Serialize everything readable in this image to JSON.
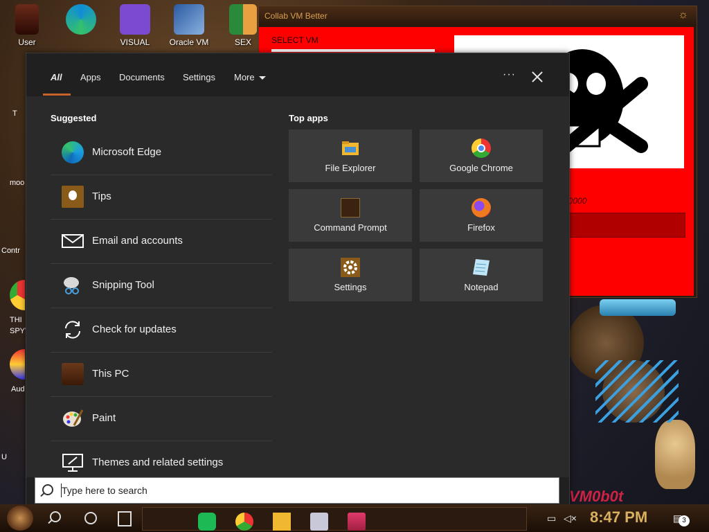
{
  "desktop": {
    "icons": [
      {
        "label": "User"
      },
      {
        "label": ""
      },
      {
        "label": "VISUAL"
      },
      {
        "label": "Oracle VM"
      },
      {
        "label": "SEX"
      }
    ],
    "left_labels": [
      "T",
      "moo",
      "Contr",
      "THI",
      "SPYV",
      "Aud",
      "U"
    ]
  },
  "collab_window": {
    "title": "Collab VM Better",
    "select_label": "SELECT VM",
    "field_text": "20000"
  },
  "watermark_text": "VM0b0t",
  "panel": {
    "tabs": [
      {
        "label": "All"
      },
      {
        "label": "Apps"
      },
      {
        "label": "Documents"
      },
      {
        "label": "Settings"
      },
      {
        "label": "More"
      }
    ],
    "more_options": "···",
    "suggested_title": "Suggested",
    "suggested": [
      {
        "label": "Microsoft Edge",
        "icon": "edge-icon"
      },
      {
        "label": "Tips",
        "icon": "tips-icon"
      },
      {
        "label": "Email and accounts",
        "icon": "mail-icon"
      },
      {
        "label": "Snipping Tool",
        "icon": "snipping-icon"
      },
      {
        "label": "Check for updates",
        "icon": "refresh-icon"
      },
      {
        "label": "This PC",
        "icon": "computer-icon"
      },
      {
        "label": "Paint",
        "icon": "paint-icon"
      },
      {
        "label": "Themes and related settings",
        "icon": "themes-icon"
      }
    ],
    "top_apps_title": "Top apps",
    "top_apps": [
      {
        "label": "File Explorer",
        "icon": "folder-icon"
      },
      {
        "label": "Google Chrome",
        "icon": "chrome-icon"
      },
      {
        "label": "Command Prompt",
        "icon": "cmd-icon"
      },
      {
        "label": "Firefox",
        "icon": "firefox-icon"
      },
      {
        "label": "Settings",
        "icon": "gear-icon"
      },
      {
        "label": "Notepad",
        "icon": "notepad-icon"
      }
    ],
    "search_placeholder": "Type here to search"
  },
  "taskbar": {
    "clock": "8:47 PM",
    "notification_count": "3"
  },
  "colors": {
    "panel_bg": "#202020",
    "content_bg": "#2a2a2a",
    "tile_bg": "#3a3a3a",
    "accent": "#c8642a",
    "collab_red": "#ff0000"
  }
}
